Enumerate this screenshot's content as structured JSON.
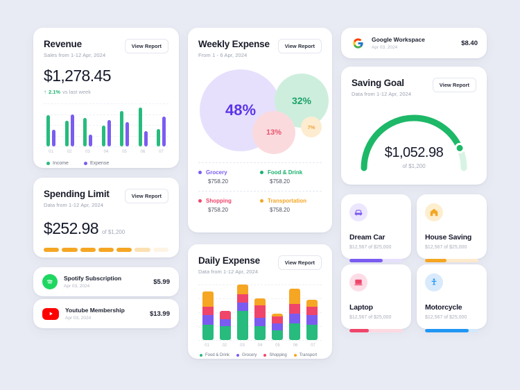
{
  "theme": {
    "background": "#e9ebf4",
    "card_bg": "#ffffff",
    "green": "#27bb7e",
    "purple": "#7b5cf0",
    "orange": "#f5a623",
    "pink": "#f0456b",
    "blue": "#2196f3"
  },
  "revenue": {
    "title": "Revenue",
    "subtitle": "Sales from 1-12 Apr, 2024",
    "amount": "$1,278.45",
    "delta_value": "2.1%",
    "delta_label": "vs last week",
    "delta_arrow": "↑",
    "view_report": "View Report",
    "chart_data": {
      "type": "bar",
      "title": "Revenue",
      "categories": [
        "01",
        "02",
        "03",
        "04",
        "05",
        "06",
        "07"
      ],
      "series": [
        {
          "name": "Income",
          "color": "#27bb7e",
          "values": [
            72,
            60,
            66,
            48,
            82,
            90,
            40
          ]
        },
        {
          "name": "Expense",
          "color": "#7b5cf0",
          "values": [
            38,
            74,
            28,
            62,
            56,
            36,
            70
          ]
        }
      ],
      "legend": [
        "Income",
        "Expense"
      ],
      "ylim": [
        0,
        100
      ],
      "grid": true,
      "xlabel": "",
      "ylabel": ""
    }
  },
  "spending_limit": {
    "title": "Spending Limit",
    "subtitle": "Data from 1-12 Apr, 2024",
    "amount": "$252.98",
    "of_label": "of $1,200",
    "view_report": "View Report",
    "segments": [
      {
        "fill": 1
      },
      {
        "fill": 1
      },
      {
        "fill": 1
      },
      {
        "fill": 1
      },
      {
        "fill": 1
      },
      {
        "fill": 0.35
      },
      {
        "fill": 0.12
      }
    ]
  },
  "subscriptions": [
    {
      "name": "Spotify Subscription",
      "date": "Apr 03, 2024",
      "amount": "$5.99",
      "icon": "spotify-icon"
    },
    {
      "name": "Youtube Membership",
      "date": "Apr 03, 2024",
      "amount": "$13.99",
      "icon": "youtube-icon"
    }
  ],
  "google_row": {
    "name": "Google Workspace",
    "date": "Apr 03, 2024",
    "amount": "$8.40",
    "icon": "google-icon"
  },
  "weekly_expense": {
    "title": "Weekly Expense",
    "subtitle": "From 1 - 6 Apr, 2024",
    "view_report": "View Report",
    "chart_data": {
      "type": "pie",
      "title": "Weekly Expense",
      "categories": [
        "Grocery",
        "Food & Drink",
        "Shopping",
        "Transportation"
      ],
      "values": [
        48,
        32,
        13,
        7
      ],
      "labels": [
        "48%",
        "32%",
        "13%",
        "7%"
      ],
      "colors": [
        "#7b5cf0",
        "#27bb7e",
        "#f0456b",
        "#f5a623"
      ],
      "legend": "bottom"
    },
    "legend": [
      {
        "name": "Grocery",
        "value": "$758.20",
        "color": "#7b5cf0"
      },
      {
        "name": "Food & Drink",
        "value": "$758.20",
        "color": "#18b26b"
      },
      {
        "name": "Shopping",
        "value": "$758.20",
        "color": "#f0456b"
      },
      {
        "name": "Transportation",
        "value": "$758.20",
        "color": "#f5a623"
      }
    ]
  },
  "daily_expense": {
    "title": "Daily Expense",
    "subtitle": "Data from 1-12 Apr, 2024",
    "view_report": "View Report",
    "chart_data": {
      "type": "bar",
      "title": "Daily Expense",
      "stacked": true,
      "categories": [
        "01",
        "02",
        "03",
        "04",
        "05",
        "06",
        "07"
      ],
      "series": [
        {
          "name": "Food & Drink",
          "color": "#27bb7e",
          "values": [
            22,
            20,
            42,
            20,
            14,
            24,
            22
          ]
        },
        {
          "name": "Grocery",
          "color": "#7b5cf0",
          "values": [
            14,
            10,
            12,
            12,
            10,
            14,
            14
          ]
        },
        {
          "name": "Shopping",
          "color": "#f0456b",
          "values": [
            12,
            12,
            12,
            18,
            10,
            14,
            12
          ]
        },
        {
          "name": "Transport",
          "color": "#f5a623",
          "values": [
            22,
            0,
            14,
            10,
            4,
            22,
            10
          ]
        }
      ],
      "legend": [
        "Food & Drink",
        "Grocery",
        "Shopping",
        "Transport"
      ],
      "grid": true,
      "ylim": [
        0,
        80
      ]
    }
  },
  "saving_goal": {
    "title": "Saving Goal",
    "subtitle": "Data from 1-12 Apr, 2024",
    "view_report": "View Report",
    "amount": "$1,052.98",
    "of_label": "of $1,200",
    "chart_data": {
      "type": "gauge",
      "value": 1052.98,
      "max": 1200,
      "percent": 87,
      "color": "#1db868",
      "track_color": "#d8f3e4"
    }
  },
  "goals": [
    {
      "name": "Dream Car",
      "progress_label": "$12,567 of $25,000",
      "percent": 62,
      "color": "#7b5cf0",
      "track": "#e6e0fd",
      "icon": "car-icon",
      "icon_bg": "#ece6fe"
    },
    {
      "name": "House Saving",
      "progress_label": "$12,567 of $25,000",
      "percent": 40,
      "color": "#f5a623",
      "track": "#fdeacd",
      "icon": "house-icon",
      "icon_bg": "#fdeecf"
    },
    {
      "name": "Laptop",
      "progress_label": "$12,567 of $25,000",
      "percent": 36,
      "color": "#f0456b",
      "track": "#fdd9e2",
      "icon": "laptop-icon",
      "icon_bg": "#fcdde7"
    },
    {
      "name": "Motorcycle",
      "progress_label": "$12,567 of $25,000",
      "percent": 82,
      "color": "#2196f3",
      "track": "#d3e9fb",
      "icon": "motorcycle-icon",
      "icon_bg": "#d8eafc"
    }
  ]
}
